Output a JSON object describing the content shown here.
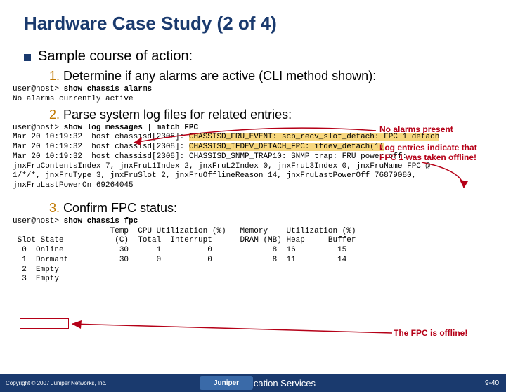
{
  "title": "Hardware Case Study (2 of 4)",
  "bullet1": "Sample course of action:",
  "item1_num": "1.",
  "item1_text": " Determine if any alarms are active (CLI method shown):",
  "cli1_prompt": "user@host> ",
  "cli1_cmd": "show chassis alarms",
  "cli1_line2": "No alarms currently active",
  "callout1": "No alarms present",
  "item2_num": "2.",
  "item2_text": " Parse system log files for related entries:",
  "callout2_l1": "Log entries indicate that",
  "callout2_l2": "FPC 1 was taken offline!",
  "log_prompt": "user@host> ",
  "log_cmd": "show log messages | match FPC",
  "log_l1a": "Mar 20 10:19:32  host chassisd[2308]: ",
  "log_l1b": "CHASSISD_FRU_EVENT: scb_recv_slot_detach: FPC 1 detach",
  "log_l2a": "Mar 20 10:19:32  host chassisd[2308]: ",
  "log_l2b": "CHASSISD_IFDEV_DETACH_FPC: ifdev_detach(1)",
  "log_l3": "Mar 20 10:19:32  host chassisd[2308]: CHASSISD_SNMP_TRAP10: SNMP trap: FRU power off:",
  "log_l4": "jnxFruContentsIndex 7, jnxFruL1Index 2, jnxFruL2Index 0, jnxFruL3Index 0, jnxFruName FPC @",
  "log_l5": "1/*/*, jnxFruType 3, jnxFruSlot 2, jnxFruOfflineReason 14, jnxFruLastPowerOff 76879080,",
  "log_l6": "jnxFruLastPowerOn 69264045",
  "item3_num": "3.",
  "item3_text": " Confirm FPC status:",
  "fpc_prompt": "user@host> ",
  "fpc_cmd": "show chassis fpc",
  "fpc_h1": "                     Temp  CPU Utilization (%)   Memory    Utilization (%)",
  "fpc_h2": " Slot State           (C)  Total  Interrupt      DRAM (MB) Heap     Buffer",
  "fpc_r0": "  0  Online            30      1          0             8  16         15",
  "fpc_r1": "  1  Dormant           30      0          0             8  11         14",
  "fpc_r2": "  2  Empty",
  "fpc_r3": "  3  Empty",
  "callout3": "The FPC is offline!",
  "copyright": "Copyright © 2007 Juniper Networks, Inc.",
  "es": "Education Services",
  "pageno": "9-40"
}
